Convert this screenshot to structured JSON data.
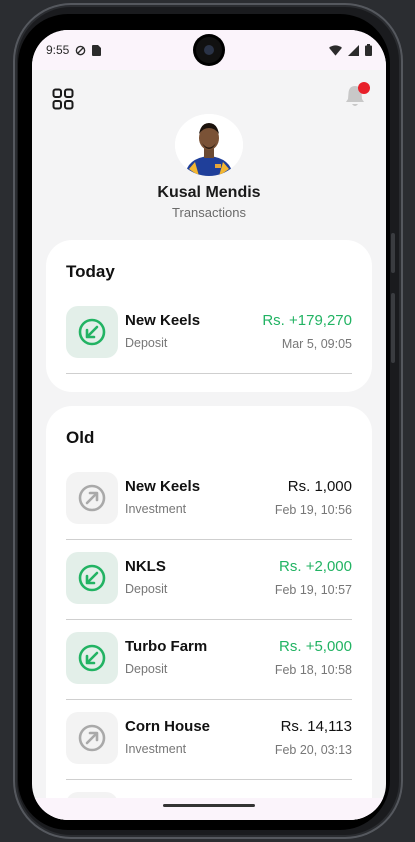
{
  "status_bar": {
    "time": "9:55",
    "icons": [
      "vpn-icon",
      "sim-icon",
      "wifi-icon",
      "signal-icon",
      "battery-icon"
    ]
  },
  "header": {
    "menu_icon": "grid-icon",
    "notification_icon": "bell-icon",
    "notification_dot_color": "#e8202a",
    "name": "Kusal Mendis",
    "subtitle": "Transactions"
  },
  "colors": {
    "positive": "#22b363",
    "deposit_icon_bg": "#e3efe9",
    "investment_icon_bg": "#f3f3f3"
  },
  "today": {
    "title": "Today",
    "transactions": [
      {
        "name": "New Keels",
        "type": "Deposit",
        "amount": "Rs. +179,270",
        "date": "Mar 5, 09:05",
        "direction": "in"
      }
    ]
  },
  "old": {
    "title": "Old",
    "transactions": [
      {
        "name": "New Keels",
        "type": "Investment",
        "amount": "Rs. 1,000",
        "date": "Feb 19, 10:56",
        "direction": "out"
      },
      {
        "name": "NKLS",
        "type": "Deposit",
        "amount": "Rs. +2,000",
        "date": "Feb 19, 10:57",
        "direction": "in"
      },
      {
        "name": "Turbo Farm",
        "type": "Deposit",
        "amount": "Rs. +5,000",
        "date": "Feb 18, 10:58",
        "direction": "in"
      },
      {
        "name": "Corn House",
        "type": "Investment",
        "amount": "Rs. 14,113",
        "date": "Feb 20, 03:13",
        "direction": "out"
      }
    ]
  }
}
